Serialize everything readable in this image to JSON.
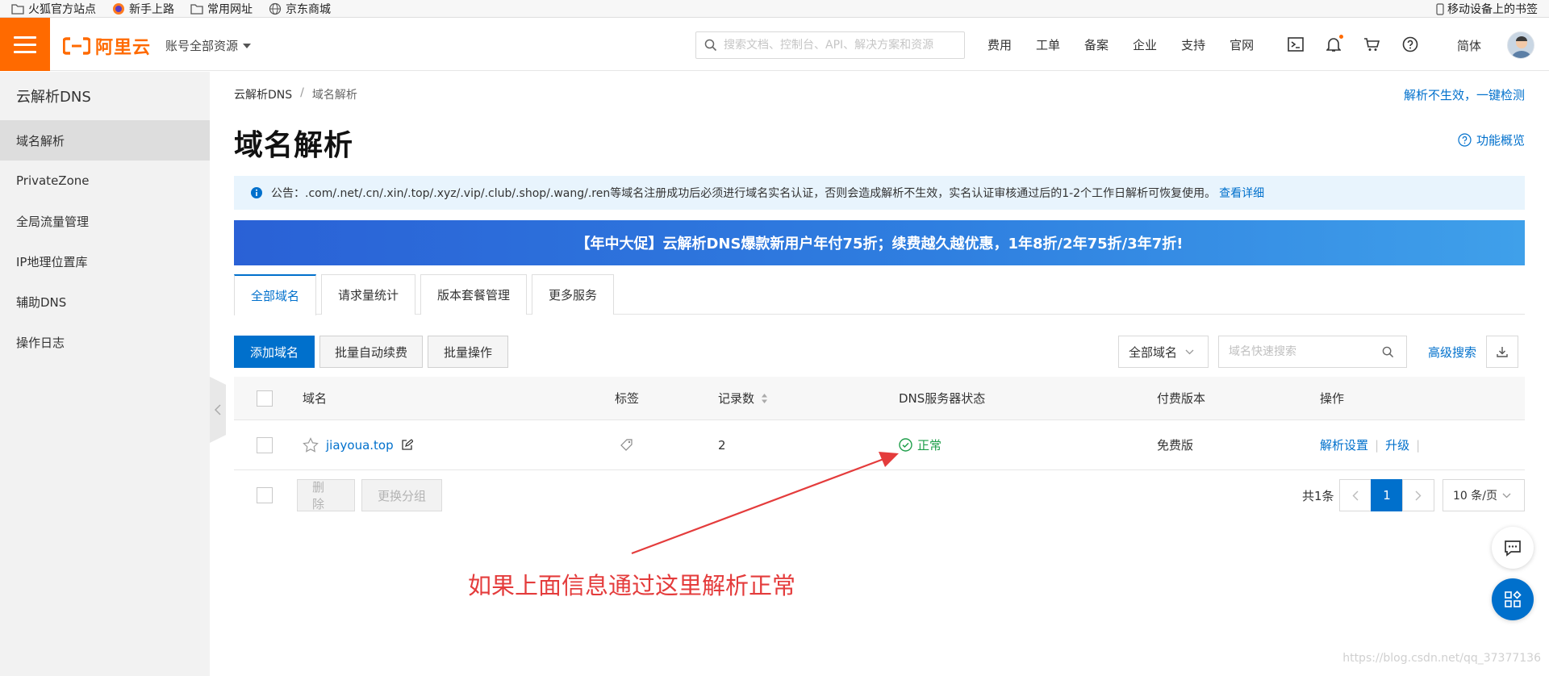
{
  "bookmarks": {
    "items": [
      "火狐官方站点",
      "新手上路",
      "常用网址",
      "京东商城"
    ],
    "mobile": "移动设备上的书签"
  },
  "topbar": {
    "logo": "阿里云",
    "account": "账号全部资源",
    "search_placeholder": "搜索文档、控制台、API、解决方案和资源",
    "links": [
      "费用",
      "工单",
      "备案",
      "企业",
      "支持",
      "官网"
    ],
    "lang": "简体",
    "icons": [
      "terminal-icon",
      "bell-icon",
      "cart-icon",
      "help-icon"
    ],
    "accent": "#ff6a00"
  },
  "sidebar": {
    "title": "云解析DNS",
    "items": [
      "域名解析",
      "PrivateZone",
      "全局流量管理",
      "IP地理位置库",
      "辅助DNS",
      "操作日志"
    ],
    "active": "域名解析"
  },
  "main": {
    "breadcrumb": [
      "云解析DNS",
      "域名解析"
    ],
    "quick_check": "解析不生效，一键检测",
    "title": "域名解析",
    "overview": "功能概览",
    "notice": "公告：.com/.net/.cn/.xin/.top/.xyz/.vip/.club/.shop/.wang/.ren等域名注册成功后必须进行域名实名认证，否则会造成解析不生效，实名认证审核通过后的1-2个工作日解析可恢复使用。",
    "notice_link": "查看详细",
    "promo": "【年中大促】云解析DNS爆款新用户年付75折；续费越久越优惠，1年8折/2年75折/3年7折!",
    "tabs": [
      "全部域名",
      "请求量统计",
      "版本套餐管理",
      "更多服务"
    ],
    "toolbar": {
      "add": "添加域名",
      "renew": "批量自动续费",
      "batch": "批量操作",
      "filter": "全部域名",
      "search_placeholder": "域名快速搜索",
      "advanced": "高级搜索"
    },
    "table": {
      "columns": [
        "域名",
        "标签",
        "记录数",
        "DNS服务器状态",
        "付费版本",
        "操作"
      ],
      "rows": [
        {
          "domain": "jiayoua.top",
          "records": "2",
          "dns_status": "正常",
          "plan": "免费版",
          "actions": [
            "解析设置",
            "升级"
          ]
        }
      ]
    },
    "footer": {
      "delete": "删 除",
      "group": "更换分组",
      "total": "共1条",
      "page": "1",
      "page_size": "10 条/页"
    }
  },
  "annotation": "如果上面信息通过这里解析正常",
  "watermark": "https://blog.csdn.net/qq_37377136"
}
